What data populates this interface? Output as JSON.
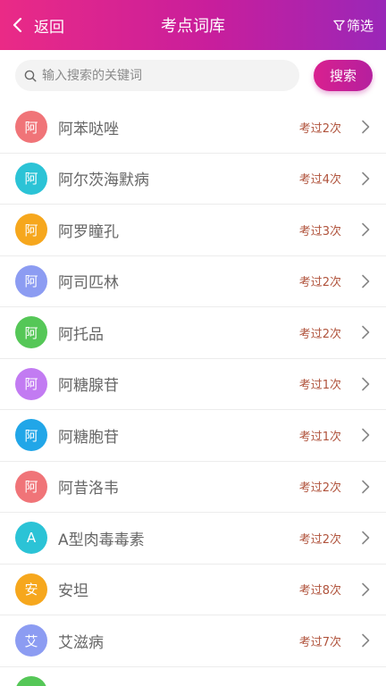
{
  "header": {
    "back_label": "返回",
    "title": "考点词库",
    "filter_label": "筛选"
  },
  "search": {
    "placeholder": "输入搜索的关键词",
    "value": "",
    "button_label": "搜索"
  },
  "terms": [
    {
      "initial": "阿",
      "name": "阿苯哒唑",
      "count": "考过2次",
      "color": "#f07478"
    },
    {
      "initial": "阿",
      "name": "阿尔茨海默病",
      "count": "考过4次",
      "color": "#2bc3d6"
    },
    {
      "initial": "阿",
      "name": "阿罗瞳孔",
      "count": "考过3次",
      "color": "#f6a71d"
    },
    {
      "initial": "阿",
      "name": "阿司匹林",
      "count": "考过2次",
      "color": "#8c9cf2"
    },
    {
      "initial": "阿",
      "name": "阿托品",
      "count": "考过2次",
      "color": "#55c757"
    },
    {
      "initial": "阿",
      "name": "阿糖腺苷",
      "count": "考过1次",
      "color": "#c27bf2"
    },
    {
      "initial": "阿",
      "name": "阿糖胞苷",
      "count": "考过1次",
      "color": "#21a6e8"
    },
    {
      "initial": "阿",
      "name": "阿昔洛韦",
      "count": "考过2次",
      "color": "#f07478"
    },
    {
      "initial": "A",
      "name": "A型肉毒毒素",
      "count": "考过2次",
      "color": "#2bc3d6"
    },
    {
      "initial": "安",
      "name": "安坦",
      "count": "考过8次",
      "color": "#f6a71d"
    },
    {
      "initial": "艾",
      "name": "艾滋病",
      "count": "考过7次",
      "color": "#8c9cf2"
    },
    {
      "initial": "",
      "name": "",
      "count": "",
      "color": "#55c757"
    }
  ],
  "colors": {
    "header_gradient_start": "#ea2a86",
    "header_gradient_end": "#9a27b8",
    "count_text": "#b0533c"
  }
}
